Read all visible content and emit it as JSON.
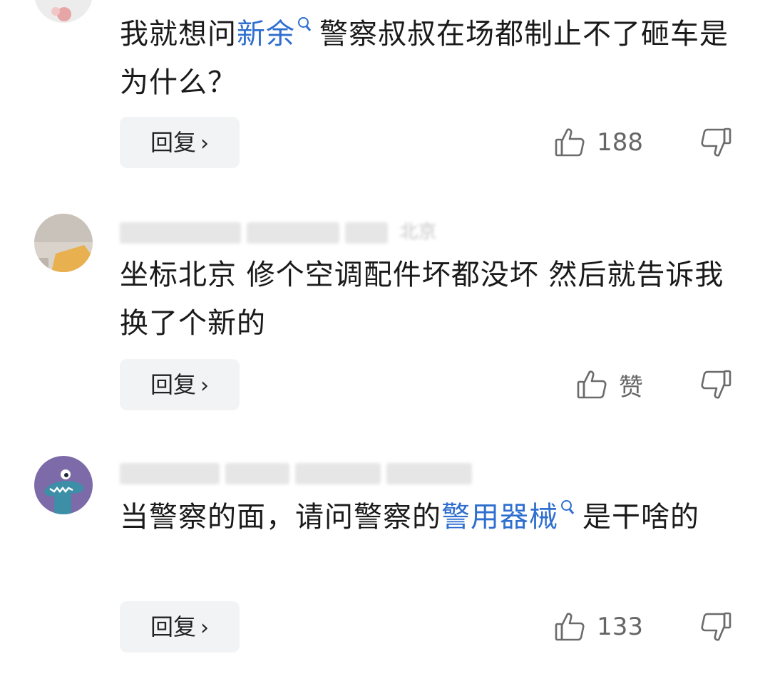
{
  "comments": [
    {
      "avatar": "avatar-partial",
      "text_before": "我就想问",
      "link": "新余",
      "text_after": "警察叔叔在场都制止不了砸车是为什么？",
      "reply_label": "回复",
      "reply_chevron": "›",
      "likes": "188"
    },
    {
      "avatar": "avatar-gray-orange",
      "meta_location": "北京",
      "text": "坐标北京 修个空调配件坏都没坏 然后就告诉我换了个新的",
      "reply_label": "回复",
      "reply_chevron": "›",
      "likes": "赞"
    },
    {
      "avatar": "avatar-purple-monster",
      "text_before": "当警察的面，请问警察的",
      "link": "警用器械",
      "text_after": "是干啥的",
      "reply_label": "回复",
      "reply_chevron": "›",
      "likes": "133"
    }
  ],
  "colors": {
    "link": "#2f6fcf",
    "reply_bg": "#f2f3f5",
    "icon": "#6b6b6b"
  },
  "icons": [
    "search-icon",
    "thumbs-up-icon",
    "thumbs-down-icon",
    "chevron-right-icon"
  ]
}
